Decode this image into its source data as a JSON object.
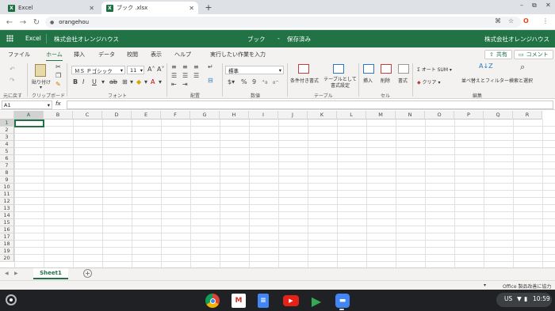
{
  "browser": {
    "tabs": [
      {
        "title": "Excel",
        "icon": "excel-icon",
        "active": false
      },
      {
        "title": "ブック .xlsx",
        "icon": "excel-icon",
        "active": true
      }
    ],
    "new_tab": "+",
    "url": "orangehou"
  },
  "excel": {
    "app_name": "Excel",
    "org_left": "株式会社オレンジハウス",
    "doc_title": "ブック",
    "dot": "-",
    "save_status": "保存済み",
    "org_right": "株式会社オレンジハウス"
  },
  "ribbon_tabs": [
    "ファイル",
    "ホーム",
    "挿入",
    "データ",
    "校閲",
    "表示",
    "ヘルプ",
    "実行したい作業を入力"
  ],
  "actions": {
    "share": "共有",
    "comment": "コメント"
  },
  "ribbon": {
    "undo_label": "元に戻す",
    "clipboard": {
      "paste": "貼り付け",
      "group": "クリップボード"
    },
    "font": {
      "name": "ＭＳ Ｐゴシック",
      "size": "11",
      "group": "フォント"
    },
    "align": {
      "group": "配置"
    },
    "number": {
      "format": "標準",
      "group": "数値"
    },
    "table": {
      "cond_format": "条件付き書式",
      "as_table": "テーブルとして\n書式設定",
      "group": "テーブル"
    },
    "cells": {
      "insert": "挿入",
      "delete": "削除",
      "format": "書式",
      "group": "セル"
    },
    "edit": {
      "autosum": "オート SUM",
      "clear": "クリア",
      "sort": "並べ替えとフィルター",
      "find": "検索と選択",
      "group": "編集"
    }
  },
  "formula": {
    "name_box": "A1",
    "fx": "fx",
    "value": ""
  },
  "columns": [
    "A",
    "B",
    "C",
    "D",
    "E",
    "F",
    "G",
    "H",
    "I",
    "J",
    "K",
    "L",
    "M",
    "N",
    "O",
    "P",
    "Q",
    "R"
  ],
  "rows": [
    "1",
    "2",
    "3",
    "4",
    "5",
    "6",
    "7",
    "8",
    "9",
    "10",
    "11",
    "12",
    "13",
    "14",
    "15",
    "16",
    "17",
    "18",
    "19",
    "20"
  ],
  "sheet": {
    "name": "Sheet1",
    "add": "+"
  },
  "status": {
    "feedback": "Office 製品改善に協力"
  },
  "shelf": {
    "apps": [
      "chrome-icon",
      "gmail-icon",
      "docs-icon",
      "youtube-icon",
      "play-store-icon",
      "files-icon"
    ],
    "locale": "US",
    "time": "10:59"
  },
  "colors": {
    "excel_green": "#217346",
    "shelf_bg": "#1f2124"
  }
}
